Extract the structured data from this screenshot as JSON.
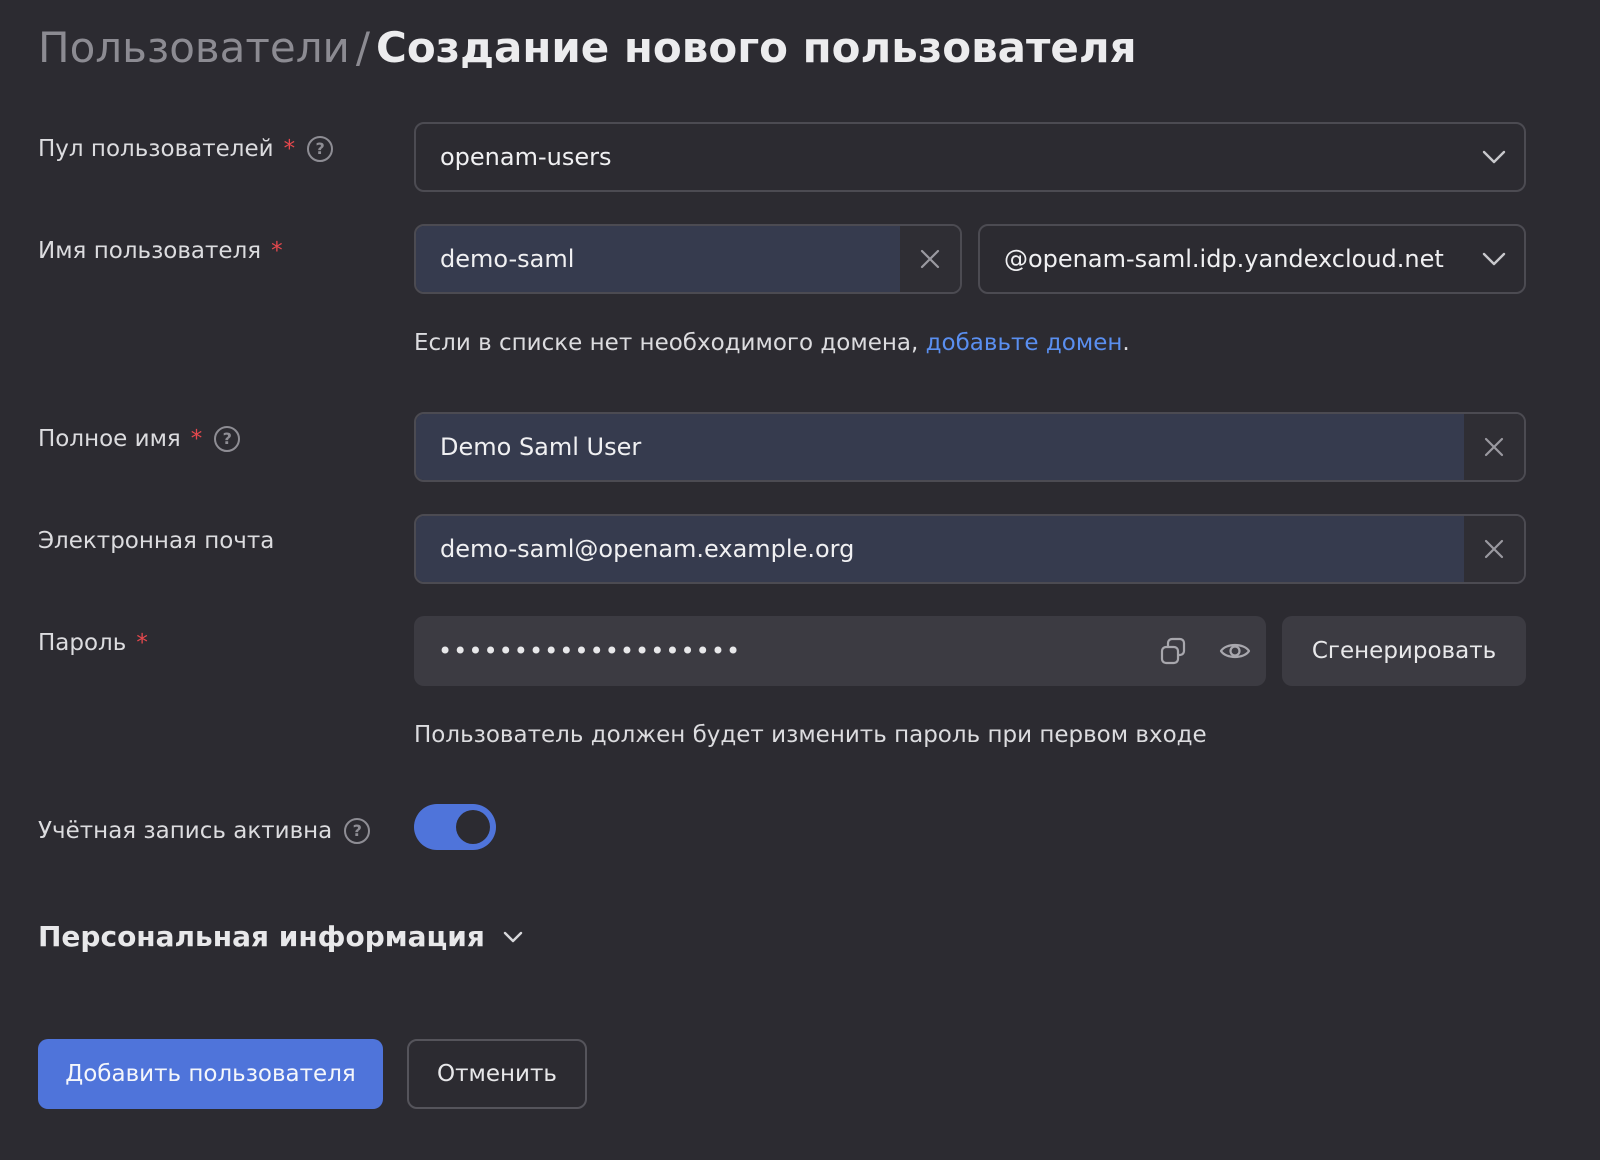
{
  "header": {
    "breadcrumb_parent": "Пользователи",
    "separator": "/",
    "title": "Создание нового пользователя"
  },
  "form": {
    "pool": {
      "label": "Пул пользователей",
      "required_mark": "*",
      "help": "?",
      "value": "openam-users"
    },
    "username": {
      "label": "Имя пользователя",
      "required_mark": "*",
      "value": "demo-saml",
      "domain": "@openam-saml.idp.yandexcloud.net",
      "hint_text": "Если в списке нет необходимого домена, ",
      "hint_link": "добавьте домен",
      "hint_end": "."
    },
    "full_name": {
      "label": "Полное имя",
      "required_mark": "*",
      "help": "?",
      "value": "Demo Saml User"
    },
    "email": {
      "label": "Электронная почта",
      "value": "demo-saml@openam.example.org"
    },
    "password": {
      "label": "Пароль",
      "required_mark": "*",
      "masked_value": "••••••••••••••••••••",
      "generate_label": "Сгенерировать",
      "hint": "Пользователь должен будет изменить пароль при первом входе"
    },
    "active": {
      "label": "Учётная запись активна",
      "help": "?",
      "enabled": true
    },
    "personal_section": "Персональная информация"
  },
  "actions": {
    "submit_label": "Добавить пользователя",
    "cancel_label": "Отменить"
  },
  "colors": {
    "background": "#2c2b31",
    "accent": "#4f74da",
    "link": "#5a8ff0",
    "required": "#e5484d"
  }
}
